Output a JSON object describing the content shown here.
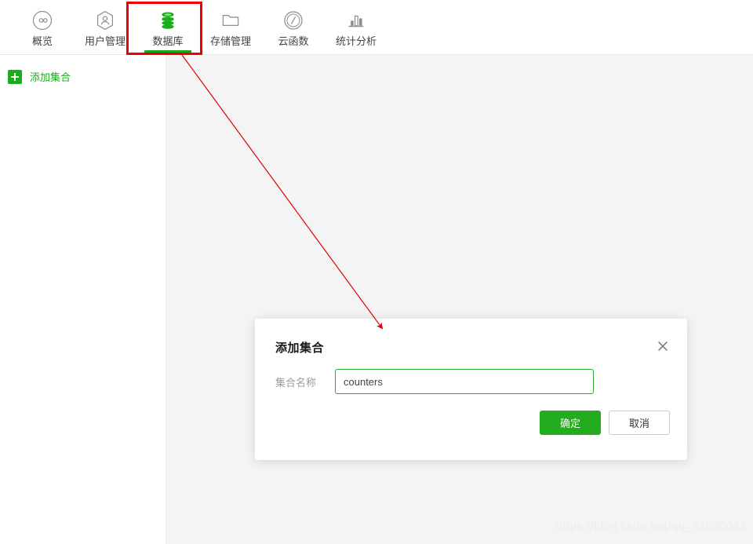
{
  "nav": {
    "items": [
      {
        "label": "概览",
        "icon": "infinity-circle-icon",
        "active": false
      },
      {
        "label": "用户管理",
        "icon": "user-hexagon-icon",
        "active": false
      },
      {
        "label": "数据库",
        "icon": "database-icon",
        "active": true
      },
      {
        "label": "存储管理",
        "icon": "folder-icon",
        "active": false
      },
      {
        "label": "云函数",
        "icon": "cloud-function-icon",
        "active": false
      },
      {
        "label": "统计分析",
        "icon": "bar-chart-icon",
        "active": false
      }
    ]
  },
  "sidebar": {
    "add_collection_label": "添加集合",
    "add_icon": "plus-icon"
  },
  "modal": {
    "title": "添加集合",
    "close_icon": "close-icon",
    "field_label": "集合名称",
    "field_value": "counters",
    "field_placeholder": "",
    "confirm_label": "确定",
    "cancel_label": "取消"
  },
  "annotation": {
    "box_color": "#ee0000",
    "arrow_color": "#dd0000"
  },
  "colors": {
    "brand_green": "#1aad19",
    "active_underline": "#15a81b",
    "content_bg": "#f4f4f4"
  },
  "watermark": {
    "text": "https://blog.csdn.net/qq_33030043"
  }
}
